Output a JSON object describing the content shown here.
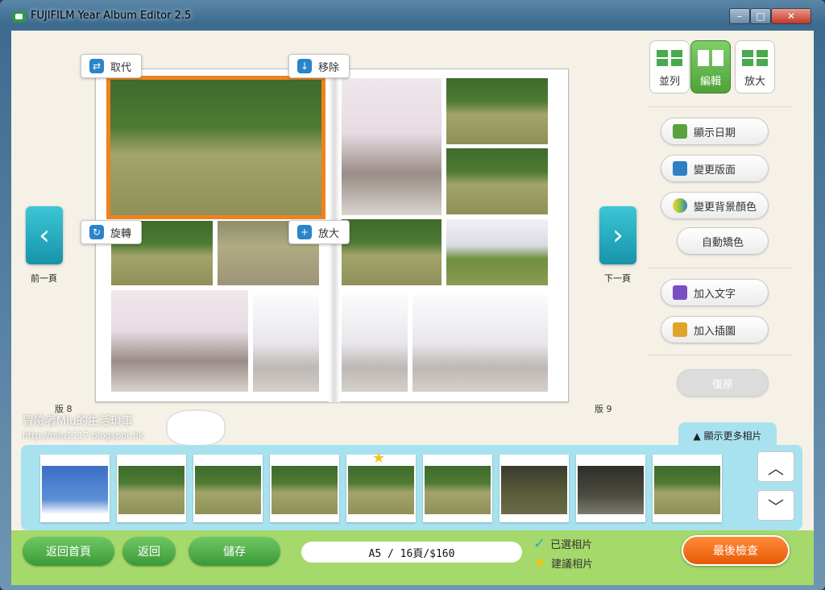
{
  "window": {
    "title": "FUJIFILM Year Album Editor 2.5",
    "min": "–",
    "max": "□",
    "close": "✕"
  },
  "album": {
    "left_page_label": "版 8",
    "right_page_label": "版 9",
    "float_buttons": {
      "replace": "取代",
      "remove": "移除",
      "rotate": "旋轉",
      "zoom": "放大"
    }
  },
  "nav": {
    "prev_glyph": "‹",
    "prev_label": "前一頁",
    "next_glyph": "›",
    "next_label": "下一頁"
  },
  "modes": [
    {
      "label": "並列"
    },
    {
      "label": "編輯"
    },
    {
      "label": "放大"
    }
  ],
  "tools": {
    "show_date": "顯示日期",
    "change_layout": "變更版面",
    "change_bg": "變更背景顏色",
    "auto_color": "自動矯色",
    "add_text": "加入文字",
    "add_clipart": "加入插圖",
    "undo": "復原"
  },
  "watermark": {
    "line1": "冒險者Miu的生活瑣事",
    "line2": "http://miu1117.blogspot.hk"
  },
  "filmstrip": {
    "more_label": "▲ 顯示更多相片",
    "up": "︿",
    "down": "﹀"
  },
  "bottom": {
    "home": "返回首頁",
    "back": "返回",
    "save": "儲存",
    "price": "A5 / 16頁/$160",
    "selected_legend": "已選相片",
    "suggested_legend": "建議相片",
    "final_check": "最後檢查"
  },
  "colors": {
    "accent_green": "#4fa23a",
    "accent_orange": "#e75a05",
    "strip_bg": "#a8e2ef",
    "nav_teal": "#1793a9"
  }
}
